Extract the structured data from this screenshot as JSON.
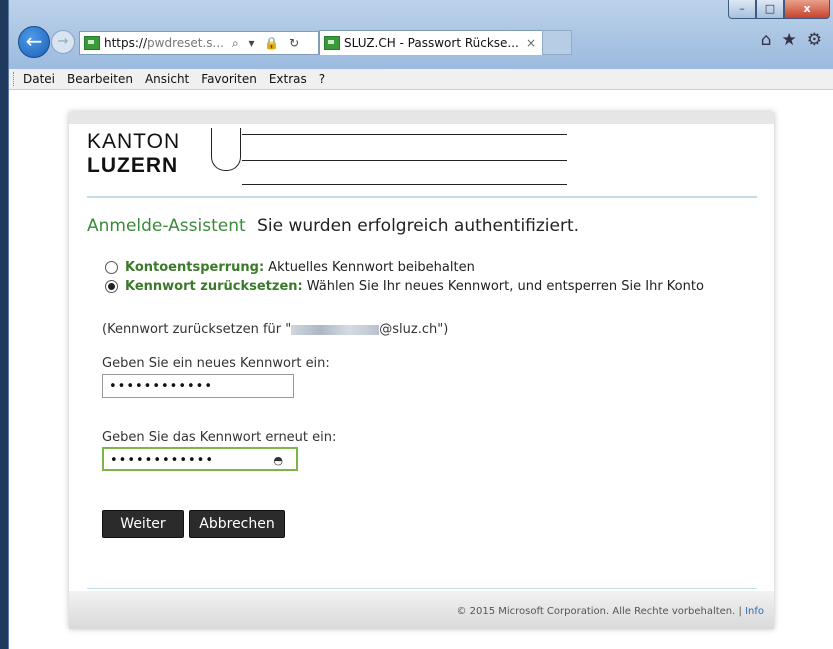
{
  "browser": {
    "address_scheme": "https://",
    "address_rest": "pwdreset.s...",
    "address_tools": "⌕ ▾ 🔒 ↻",
    "tab_title": "SLUZ.CH - Passwort Rückse...",
    "tab_close": "×",
    "back_glyph": "←",
    "forward_glyph": "→",
    "caption": {
      "minimize": "–",
      "maximize": "□",
      "close": "x"
    },
    "icons": {
      "home": "⌂",
      "favorites": "★",
      "settings": "⚙"
    }
  },
  "menu": [
    "Datei",
    "Bearbeiten",
    "Ansicht",
    "Favoriten",
    "Extras",
    "?"
  ],
  "logo": {
    "line1": "KANTON",
    "line2": "LUZERN"
  },
  "page": {
    "step": "Anmelde-Assistent",
    "title": "Sie wurden erfolgreich authentifiziert.",
    "options": [
      {
        "bold": "Kontoentsperrung:",
        "text": "Aktuelles Kennwort beibehalten",
        "selected": false
      },
      {
        "bold": "Kennwort zurücksetzen:",
        "text": "Wählen Sie Ihr neues Kennwort, und entsperren Sie Ihr Konto",
        "selected": true
      }
    ],
    "note_prefix": "(Kennwort zurücksetzen für \"",
    "note_suffix": "@sluz.ch\")",
    "new_pw_label": "Geben Sie ein neues Kennwort ein:",
    "new_pw_value": "••••••••••••",
    "confirm_pw_label": "Geben Sie das Kennwort erneut ein:",
    "confirm_pw_value": "••••••••••••",
    "reveal_glyph": "◓",
    "next_button": "Weiter",
    "cancel_button": "Abbrechen"
  },
  "footer": {
    "copyright": "© 2015 Microsoft Corporation. Alle Rechte vorbehalten.",
    "separator": "|",
    "info": "Info"
  },
  "colors": {
    "accent_green": "#3b8a3b",
    "focus_border": "#7ab648",
    "button_bg": "#2b2b2b",
    "link_blue": "#2a6eb8"
  }
}
